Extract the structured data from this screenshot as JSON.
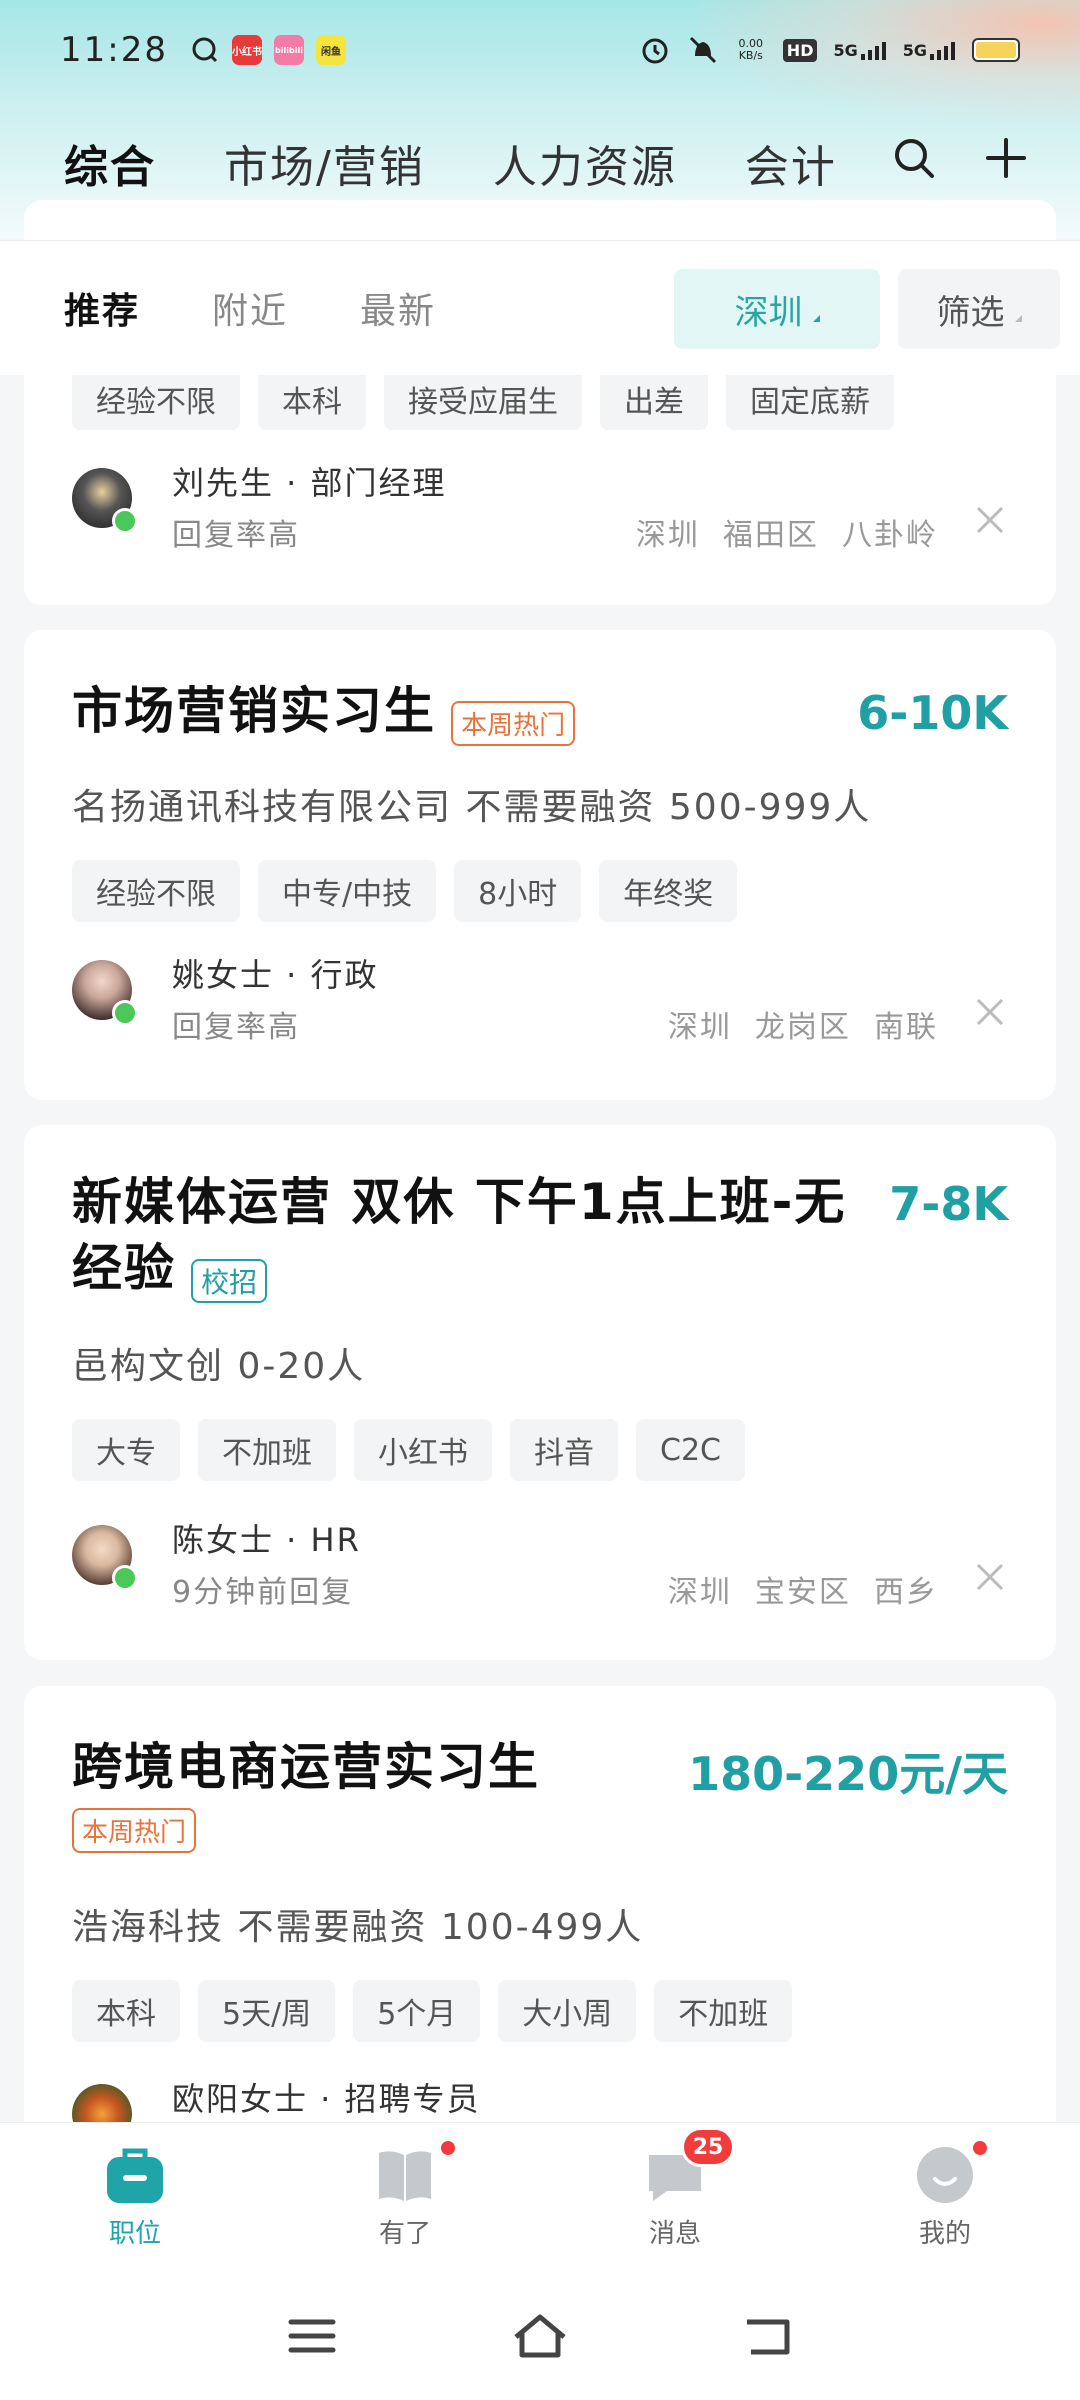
{
  "status_bar": {
    "time": "11:28",
    "apps": [
      {
        "icon": "chat-bubble-icon",
        "label": ""
      },
      {
        "icon": "xiaohongshu-icon",
        "label": "小红书",
        "color": "#e83a3a"
      },
      {
        "icon": "bilibili-icon",
        "label": "bilibili",
        "color": "#f37ba6"
      },
      {
        "icon": "app-icon",
        "label": "闲鱼",
        "color": "#f5e43a"
      }
    ],
    "net_speed": "0.00\nKB/s",
    "hd_label": "HD",
    "sim1": "5G",
    "sim2": "5G"
  },
  "categories": [
    "综合",
    "市场/营销",
    "人力资源",
    "会计"
  ],
  "sub_tabs": [
    "推荐",
    "附近",
    "最新"
  ],
  "city_chip": "深圳",
  "filter_chip": "筛选",
  "card0": {
    "tags": [
      "经验不限",
      "本科",
      "接受应届生",
      "出差",
      "固定底薪"
    ],
    "recruiter_name": "刘先生 · 部门经理",
    "reply": "回复率高",
    "location": "深圳  福田区  八卦岭"
  },
  "card1": {
    "title": "市场营销实习生",
    "badge": "本周热门",
    "salary": "6-10K",
    "company": "名扬通讯科技有限公司 不需要融资 500-999人",
    "tags": [
      "经验不限",
      "中专/中技",
      "8小时",
      "年终奖"
    ],
    "recruiter_name": "姚女士 · 行政",
    "reply": "回复率高",
    "location": "深圳  龙岗区  南联"
  },
  "card2": {
    "title_line1": "新媒体运营 双休 下午1点上班-无",
    "title_line2": "经验",
    "badge": "校招",
    "salary": "7-8K",
    "company": "邑构文创 0-20人",
    "tags": [
      "大专",
      "不加班",
      "小红书",
      "抖音",
      "C2C"
    ],
    "recruiter_name": "陈女士 · HR",
    "reply": "9分钟前回复",
    "location": "深圳  宝安区  西乡"
  },
  "card3": {
    "title": "跨境电商运营实习生",
    "badge": "本周热门",
    "salary": "180-220元/天",
    "company": "浩海科技 不需要融资 100-499人",
    "tags": [
      "本科",
      "5天/周",
      "5个月",
      "大小周",
      "不加班"
    ],
    "recruiter_name": "欧阳女士 · 招聘专员"
  },
  "bottom_nav": [
    {
      "label": "职位",
      "icon": "briefcase-icon",
      "active": true
    },
    {
      "label": "有了",
      "icon": "book-icon",
      "dot": true
    },
    {
      "label": "消息",
      "icon": "message-icon",
      "badge": "25"
    },
    {
      "label": "我的",
      "icon": "profile-icon",
      "dot": true
    }
  ],
  "colors": {
    "accent": "#20a0a4",
    "hot": "#e8743b",
    "online": "#4cc75a",
    "badge": "#f23c3c"
  }
}
